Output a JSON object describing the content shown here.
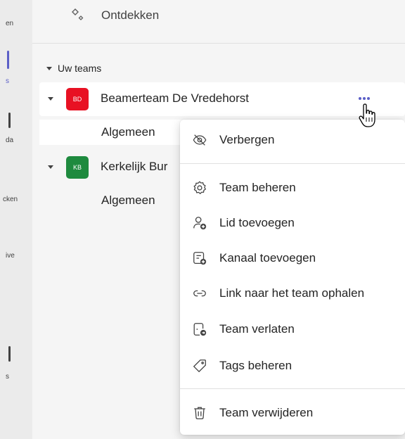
{
  "rail": {
    "items": [
      {
        "label": "en"
      },
      {
        "label": "s"
      },
      {
        "label": "da"
      },
      {
        "label": "cken"
      },
      {
        "label": "ive"
      },
      {
        "label": "s"
      }
    ]
  },
  "discover": {
    "label": "Ontdekken",
    "icon": "sparkle-icon"
  },
  "teams_section": {
    "label": "Uw teams"
  },
  "teams": [
    {
      "initials": "BD",
      "color": "#e81123",
      "name": "Beamerteam De Vredehorst",
      "channels": [
        {
          "name": "Algemeen"
        }
      ]
    },
    {
      "initials": "KB",
      "color": "#1e8a3e",
      "name": "Kerkelijk Bur",
      "channels": [
        {
          "name": "Algemeen"
        }
      ]
    }
  ],
  "menu": {
    "items": [
      {
        "label": "Verbergen",
        "icon": "eye-off-icon"
      },
      {
        "label": "Team beheren",
        "icon": "gear-icon"
      },
      {
        "label": "Lid toevoegen",
        "icon": "person-add-icon"
      },
      {
        "label": "Kanaal toevoegen",
        "icon": "channel-add-icon"
      },
      {
        "label": "Link naar het team ophalen",
        "icon": "link-icon"
      },
      {
        "label": "Team verlaten",
        "icon": "leave-icon"
      },
      {
        "label": "Tags beheren",
        "icon": "tag-icon"
      },
      {
        "label": "Team verwijderen",
        "icon": "trash-icon"
      }
    ]
  },
  "colors": {
    "accent": "#5b5fc7",
    "menu_bg": "#ffffff",
    "panel_bg": "#f5f5f5"
  }
}
